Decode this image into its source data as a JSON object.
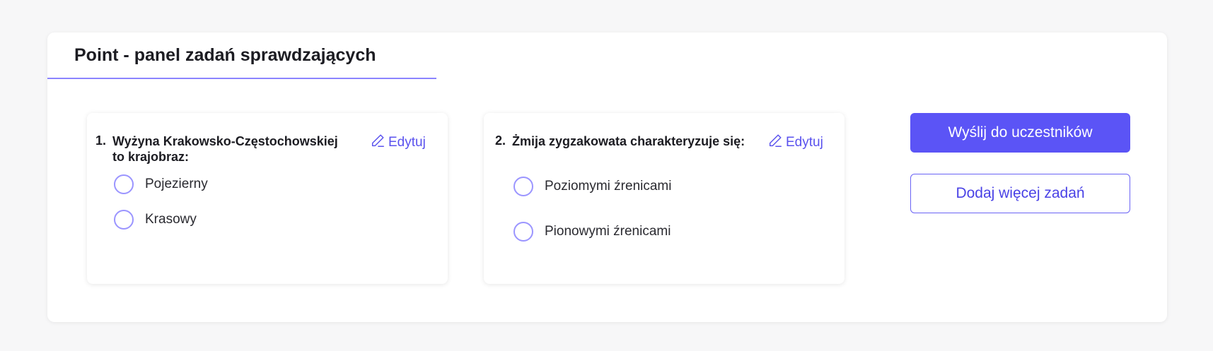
{
  "panel": {
    "title": "Point - panel zadań sprawdzających"
  },
  "questions": [
    {
      "number": "1.",
      "text": "Wyżyna Krakowsko-Częstochowskiej to krajobraz:",
      "edit_label": "Edytuj",
      "options": [
        "Pojezierny",
        "Krasowy"
      ]
    },
    {
      "number": "2.",
      "text": "Żmija zygzakowata charakteryzuje się:",
      "edit_label": "Edytuj",
      "options": [
        "Poziomymi źrenicami",
        "Pionowymi źrenicami"
      ]
    }
  ],
  "actions": {
    "send_label": "Wyślij do uczestników",
    "add_label": "Dodaj więcej zadań"
  },
  "icons": {
    "edit": "pencil-icon"
  },
  "colors": {
    "accent": "#5b54f6",
    "radio_border": "#9b95ff",
    "header_underline": "#8b84ff"
  }
}
